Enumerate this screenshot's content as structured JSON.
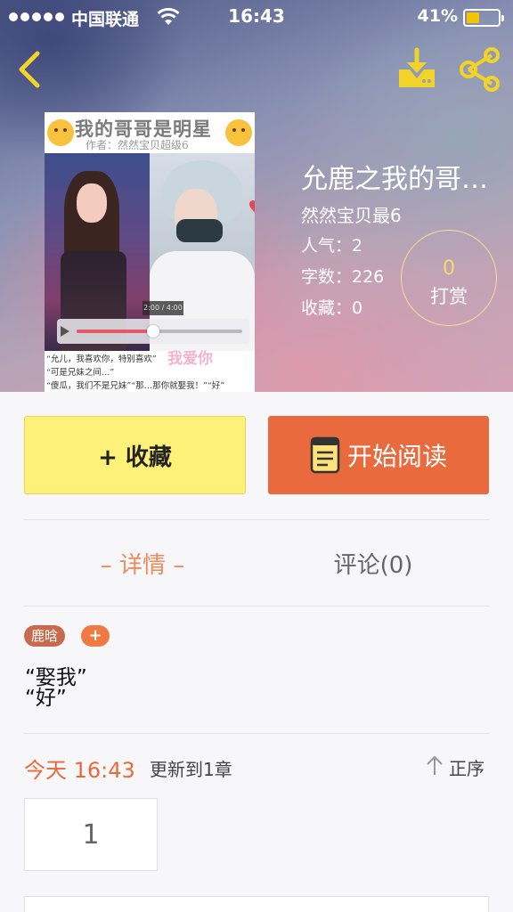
{
  "status_bar": {
    "carrier": "中国联通",
    "time": "16:43",
    "battery_percent": "41%",
    "battery_level": 0.41,
    "signal_bars": 5
  },
  "nav": {
    "back_icon": "chevron-left-icon",
    "download_icon": "download-icon",
    "share_icon": "share-icon",
    "icon_color": "#f2d32a"
  },
  "cover": {
    "title": "我的哥哥是明星",
    "author_line": "作者：然然宝贝超级6",
    "player_time": "2:00 / 4:00",
    "player_progress": 0.46,
    "quote_lines": [
      "“允儿，我喜欢你，特别喜欢”",
      "“可是兄妹之间…”",
      "“傻瓜，我们不是兄妹”“那…那你就娶我！”“好”"
    ],
    "love_text": "我爱你"
  },
  "book": {
    "title": "允鹿之我的哥…",
    "author": "然然宝贝最6",
    "popularity": "人气：2",
    "word_count": "字数：226",
    "favorites": "收藏：0",
    "reward_count": "0",
    "reward_label": "打赏"
  },
  "actions": {
    "favorite_label": "+ 收藏",
    "read_label": "开始阅读",
    "favorite_color": "#fdf17a",
    "read_color": "#e96b3d"
  },
  "tabs": {
    "details": "– 详情 –",
    "comments": "评论(0)"
  },
  "tags": {
    "items": [
      "鹿晗"
    ],
    "add": "+"
  },
  "synopsis": {
    "lines": [
      "“娶我”",
      "“好”"
    ]
  },
  "update": {
    "time": "今天 16:43",
    "text": "更新到1章",
    "sort_label": "正序"
  },
  "chapters": [
    "1"
  ]
}
